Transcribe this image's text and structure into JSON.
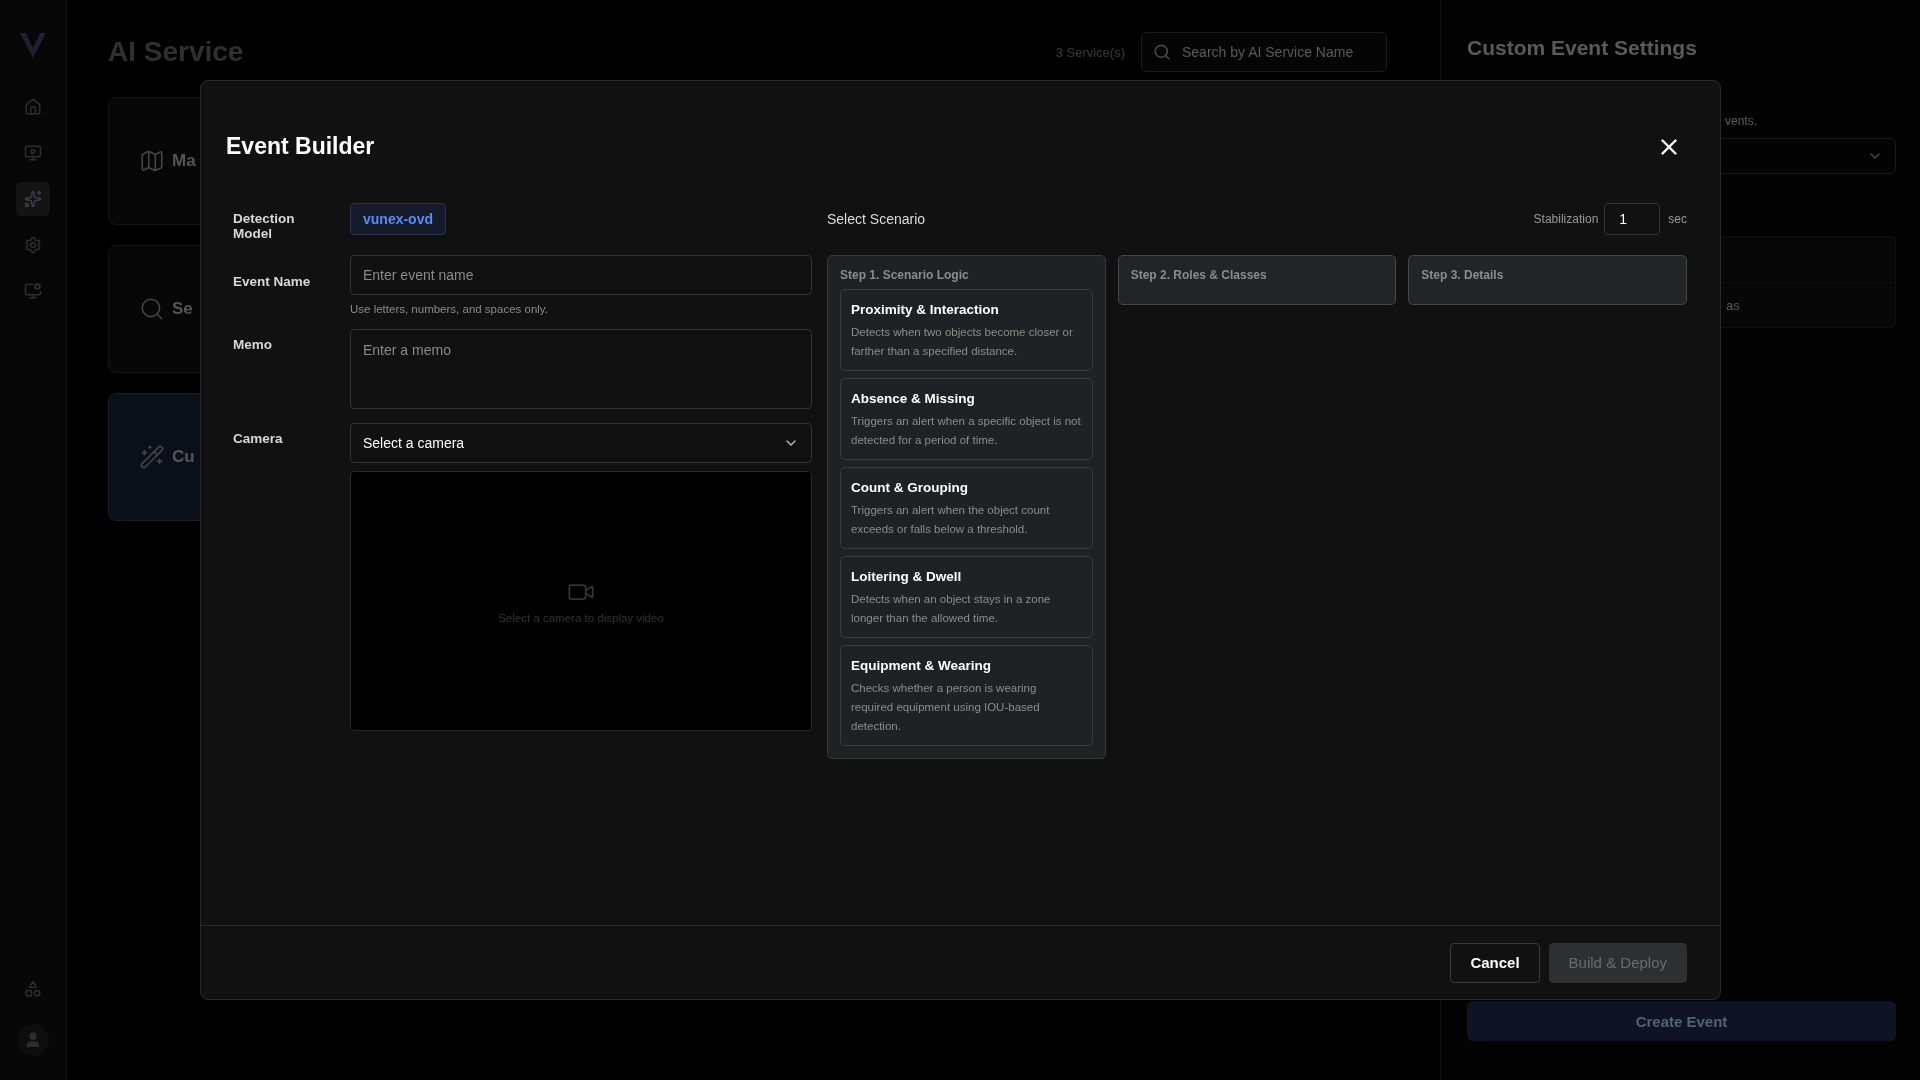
{
  "sidebar": {
    "items": [
      {
        "selected": false
      },
      {
        "selected": false
      },
      {
        "selected": true
      },
      {
        "selected": false
      },
      {
        "selected": false
      }
    ]
  },
  "page": {
    "title": "AI Service",
    "count": "3 Service(s)",
    "search": {
      "placeholder": "Search by AI Service Name"
    }
  },
  "services": [
    {
      "label": "Ma",
      "selected": false
    },
    {
      "label": "Se",
      "selected": false
    },
    {
      "label": "Cu",
      "selected": true
    }
  ],
  "settings_panel": {
    "title": "Custom Event Settings",
    "description": "vents.",
    "row_text": "as",
    "create_button": "Create Event"
  },
  "dialog": {
    "title": "Event Builder",
    "detection_model": {
      "label": "Detection Model",
      "value": "vunex-ovd"
    },
    "event_name": {
      "label": "Event Name",
      "placeholder": "Enter event name",
      "hint": "Use letters, numbers, and spaces only."
    },
    "memo": {
      "label": "Memo",
      "placeholder": "Enter a memo"
    },
    "camera": {
      "label": "Camera",
      "value": "Select a camera",
      "preview_message": "Select a camera to display video"
    },
    "scenario": {
      "label": "Select Scenario",
      "stabilization": {
        "label": "Stabilization",
        "value": "1",
        "unit": "sec"
      },
      "steps": [
        {
          "title": "Step 1. Scenario Logic",
          "expanded": true,
          "options": [
            {
              "title": "Proximity & Interaction",
              "description": "Detects when two objects become closer or farther than a specified distance.",
              "selected": false
            },
            {
              "title": "Absence & Missing",
              "description": "Triggers an alert when a specific object is not detected for a period of time.",
              "selected": false
            },
            {
              "title": "Count & Grouping",
              "description": "Triggers an alert when the object count exceeds or falls below a threshold.",
              "selected": false
            },
            {
              "title": "Loitering & Dwell",
              "description": "Detects when an object stays in a zone longer than the allowed time.",
              "selected": false
            },
            {
              "title": "Equipment & Wearing",
              "description": "Checks whether a person is wearing required equipment using IOU-based detection.",
              "selected": false
            }
          ]
        },
        {
          "title": "Step 2. Roles & Classes",
          "expanded": false
        },
        {
          "title": "Step 3. Details",
          "expanded": false
        }
      ]
    },
    "buttons": [
      {
        "label": "Cancel",
        "disabled": false
      },
      {
        "label": "Build & Deploy",
        "disabled": true
      }
    ]
  }
}
